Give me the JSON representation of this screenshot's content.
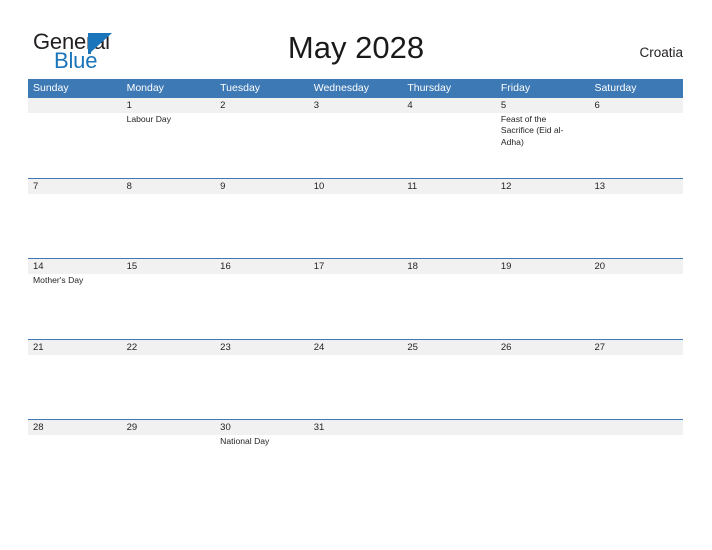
{
  "brand": {
    "name_part1": "General",
    "name_part2": "Blue",
    "flag_icon": "blue-triangle-flag-icon",
    "accent_color": "#1b75bb"
  },
  "header": {
    "title": "May 2028",
    "country": "Croatia"
  },
  "colors": {
    "header_blue": "#3d79b5",
    "number_band_gray": "#f1f1f1",
    "text": "#231f20",
    "logo_blue": "#1b75bb"
  },
  "calendar": {
    "weekdays": [
      "Sunday",
      "Monday",
      "Tuesday",
      "Wednesday",
      "Thursday",
      "Friday",
      "Saturday"
    ],
    "weeks": [
      {
        "days": [
          {
            "date": "",
            "event": ""
          },
          {
            "date": "1",
            "event": "Labour Day"
          },
          {
            "date": "2",
            "event": ""
          },
          {
            "date": "3",
            "event": ""
          },
          {
            "date": "4",
            "event": ""
          },
          {
            "date": "5",
            "event": "Feast of the Sacrifice (Eid al-Adha)"
          },
          {
            "date": "6",
            "event": ""
          }
        ]
      },
      {
        "days": [
          {
            "date": "7",
            "event": ""
          },
          {
            "date": "8",
            "event": ""
          },
          {
            "date": "9",
            "event": ""
          },
          {
            "date": "10",
            "event": ""
          },
          {
            "date": "11",
            "event": ""
          },
          {
            "date": "12",
            "event": ""
          },
          {
            "date": "13",
            "event": ""
          }
        ]
      },
      {
        "days": [
          {
            "date": "14",
            "event": "Mother's Day"
          },
          {
            "date": "15",
            "event": ""
          },
          {
            "date": "16",
            "event": ""
          },
          {
            "date": "17",
            "event": ""
          },
          {
            "date": "18",
            "event": ""
          },
          {
            "date": "19",
            "event": ""
          },
          {
            "date": "20",
            "event": ""
          }
        ]
      },
      {
        "days": [
          {
            "date": "21",
            "event": ""
          },
          {
            "date": "22",
            "event": ""
          },
          {
            "date": "23",
            "event": ""
          },
          {
            "date": "24",
            "event": ""
          },
          {
            "date": "25",
            "event": ""
          },
          {
            "date": "26",
            "event": ""
          },
          {
            "date": "27",
            "event": ""
          }
        ]
      },
      {
        "days": [
          {
            "date": "28",
            "event": ""
          },
          {
            "date": "29",
            "event": ""
          },
          {
            "date": "30",
            "event": "National Day"
          },
          {
            "date": "31",
            "event": ""
          },
          {
            "date": "",
            "event": ""
          },
          {
            "date": "",
            "event": ""
          },
          {
            "date": "",
            "event": ""
          }
        ]
      }
    ]
  }
}
